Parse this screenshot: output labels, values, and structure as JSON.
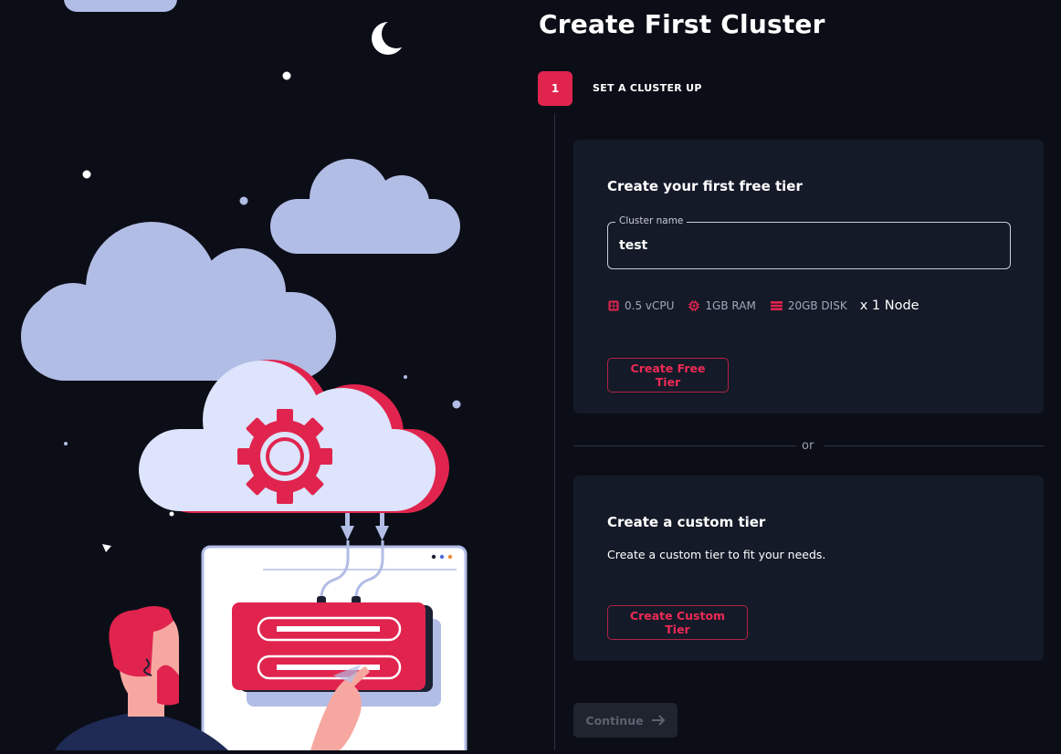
{
  "page": {
    "title": "Create First Cluster"
  },
  "step": {
    "number": "1",
    "label": "SET A CLUSTER UP"
  },
  "free_tier": {
    "title": "Create your first free tier",
    "cluster_name_label": "Cluster name",
    "cluster_name_value": "test",
    "specs": {
      "cpu": "0.5 vCPU",
      "ram": "1GB RAM",
      "disk": "20GB DISK",
      "nodes": "x 1 Node"
    },
    "button_label": "Create Free Tier"
  },
  "divider": {
    "label": "or"
  },
  "custom_tier": {
    "title": "Create a custom tier",
    "description": "Create a custom tier to fit your needs.",
    "button_label": "Create Custom Tier"
  },
  "continue_button": {
    "label": "Continue",
    "icon": "arrow-right-icon",
    "disabled": true
  },
  "colors": {
    "background": "#0b0e17",
    "card": "#141a28",
    "accent": "#e0244e",
    "cloud": "#b2bde6",
    "cloud_light": "#dde4fb"
  }
}
